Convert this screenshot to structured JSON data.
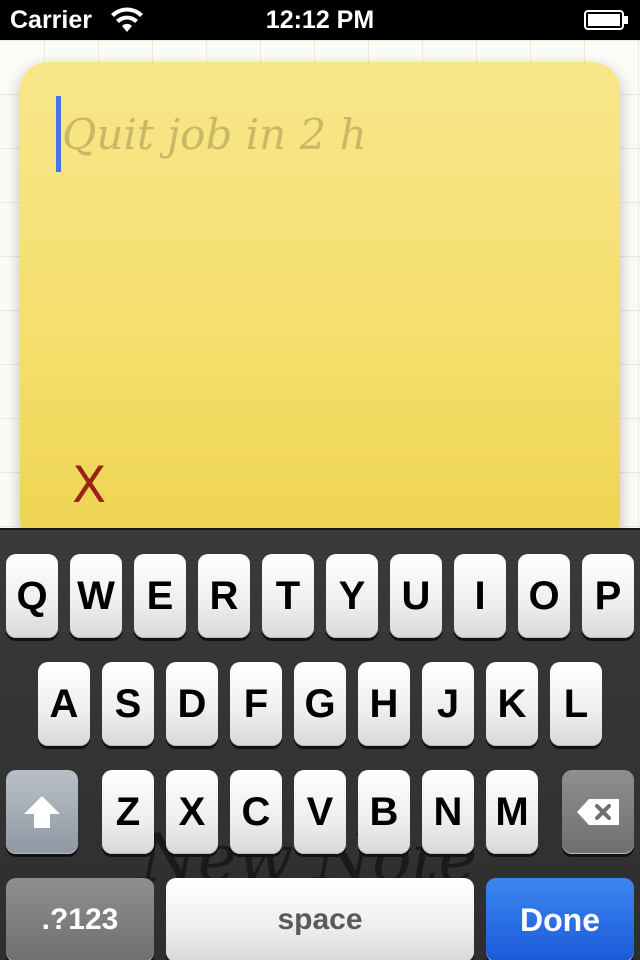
{
  "status_bar": {
    "carrier": "Carrier",
    "time": "12:12 PM"
  },
  "note": {
    "text": "Quit job in 2 h",
    "delete_label": "X"
  },
  "background_hint": "New Note",
  "keyboard": {
    "row1": [
      "Q",
      "W",
      "E",
      "R",
      "T",
      "Y",
      "U",
      "I",
      "O",
      "P"
    ],
    "row2": [
      "A",
      "S",
      "D",
      "F",
      "G",
      "H",
      "J",
      "K",
      "L"
    ],
    "row3": [
      "Z",
      "X",
      "C",
      "V",
      "B",
      "N",
      "M"
    ],
    "numbers_label": ".?123",
    "space_label": "space",
    "done_label": "Done"
  },
  "icons": {
    "wifi": "wifi-icon",
    "battery": "battery-icon",
    "shift": "shift-icon",
    "backspace": "backspace-icon"
  },
  "colors": {
    "note_yellow": "#f5df6e",
    "done_blue": "#1a5ad9",
    "cursor_blue": "#4a73ea",
    "delete_red": "#9a2418"
  }
}
